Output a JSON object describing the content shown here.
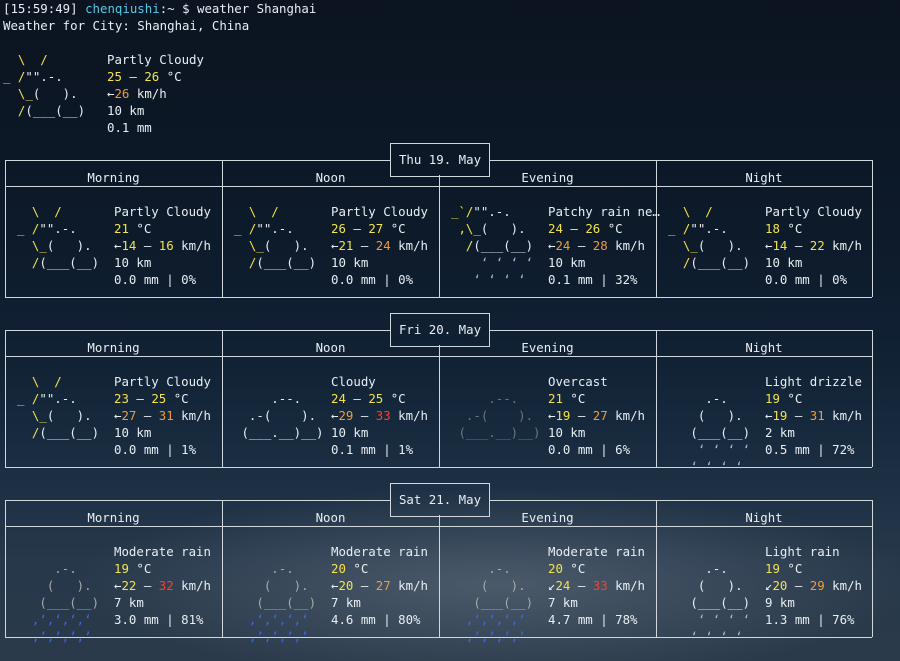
{
  "prompt": {
    "time": "[15:59:49]",
    "user": "chenqiushi",
    "sep": ":~",
    "cmd": "$ weather Shanghai"
  },
  "location_line": "Weather for City: Shanghai, China",
  "current": {
    "condition": "Partly Cloudy",
    "temp_lo": "25",
    "temp_hi": "26",
    "unit": "°C",
    "wind_arrow": "←",
    "wind": "26",
    "wind_unit": "km/h",
    "visibility": "10 km",
    "precip": "0.1 mm"
  },
  "period_labels": [
    "Morning",
    "Noon",
    "Evening",
    "Night"
  ],
  "days": [
    {
      "date": "Thu 19. May",
      "periods": [
        {
          "icon": "partly-cloudy",
          "condition": "Partly Cloudy",
          "t1": "21",
          "t2": "",
          "t1c": "y",
          "t2c": "",
          "arrow": "←",
          "w1": "14",
          "w2": "16",
          "w1c": "y",
          "w2c": "y",
          "vis": "10 km",
          "precip": "0.0 mm | 0%"
        },
        {
          "icon": "partly-cloudy",
          "condition": "Partly Cloudy",
          "t1": "26",
          "t2": "27",
          "t1c": "y",
          "t2c": "y",
          "arrow": "←",
          "w1": "21",
          "w2": "24",
          "w1c": "y",
          "w2c": "o",
          "vis": "10 km",
          "precip": "0.0 mm | 0%"
        },
        {
          "icon": "patchy-rain",
          "condition": "Patchy rain ne…",
          "t1": "24",
          "t2": "26",
          "t1c": "y",
          "t2c": "y",
          "arrow": "←",
          "w1": "24",
          "w2": "28",
          "w1c": "o",
          "w2c": "o",
          "vis": "10 km",
          "precip": "0.1 mm | 32%"
        },
        {
          "icon": "partly-cloudy",
          "condition": "Partly Cloudy",
          "t1": "18",
          "t2": "",
          "t1c": "y",
          "t2c": "",
          "arrow": "←",
          "w1": "14",
          "w2": "22",
          "w1c": "y",
          "w2c": "y",
          "vis": "10 km",
          "precip": "0.0 mm | 0%"
        }
      ]
    },
    {
      "date": "Fri 20. May",
      "periods": [
        {
          "icon": "partly-cloudy",
          "condition": "Partly Cloudy",
          "t1": "23",
          "t2": "25",
          "t1c": "y",
          "t2c": "y",
          "arrow": "←",
          "w1": "27",
          "w2": "31",
          "w1c": "o",
          "w2c": "o",
          "vis": "10 km",
          "precip": "0.0 mm | 1%"
        },
        {
          "icon": "cloudy",
          "condition": "Cloudy",
          "t1": "24",
          "t2": "25",
          "t1c": "y",
          "t2c": "y",
          "arrow": "←",
          "w1": "29",
          "w2": "33",
          "w1c": "o",
          "w2c": "r",
          "vis": "10 km",
          "precip": "0.1 mm | 1%"
        },
        {
          "icon": "overcast",
          "condition": "Overcast",
          "t1": "21",
          "t2": "",
          "t1c": "y",
          "t2c": "",
          "arrow": "←",
          "w1": "19",
          "w2": "27",
          "w1c": "y",
          "w2c": "o",
          "vis": "10 km",
          "precip": "0.0 mm | 6%"
        },
        {
          "icon": "light-drizzle",
          "condition": "Light drizzle",
          "t1": "19",
          "t2": "",
          "t1c": "y",
          "t2c": "",
          "arrow": "←",
          "w1": "19",
          "w2": "31",
          "w1c": "y",
          "w2c": "o",
          "vis": "2 km",
          "precip": "0.5 mm | 72%"
        }
      ]
    },
    {
      "date": "Sat 21. May",
      "periods": [
        {
          "icon": "moderate-rain",
          "condition": "Moderate rain",
          "t1": "19",
          "t2": "",
          "t1c": "y",
          "t2c": "",
          "arrow": "←",
          "w1": "22",
          "w2": "32",
          "w1c": "y",
          "w2c": "r",
          "vis": "7 km",
          "precip": "3.0 mm | 81%"
        },
        {
          "icon": "moderate-rain",
          "condition": "Moderate rain",
          "t1": "20",
          "t2": "",
          "t1c": "y",
          "t2c": "",
          "arrow": "←",
          "w1": "20",
          "w2": "27",
          "w1c": "y",
          "w2c": "o",
          "vis": "7 km",
          "precip": "4.6 mm | 80%"
        },
        {
          "icon": "moderate-rain",
          "condition": "Moderate rain",
          "t1": "20",
          "t2": "",
          "t1c": "y",
          "t2c": "",
          "arrow": "↙",
          "w1": "24",
          "w2": "33",
          "w1c": "y",
          "w2c": "r",
          "vis": "7 km",
          "precip": "4.7 mm | 78%"
        },
        {
          "icon": "light-rain",
          "condition": "Light rain",
          "t1": "19",
          "t2": "",
          "t1c": "y",
          "t2c": "",
          "arrow": "↙",
          "w1": "20",
          "w2": "29",
          "w1c": "y",
          "w2c": "o",
          "vis": "9 km",
          "precip": "1.3 mm | 76%"
        }
      ]
    }
  ]
}
